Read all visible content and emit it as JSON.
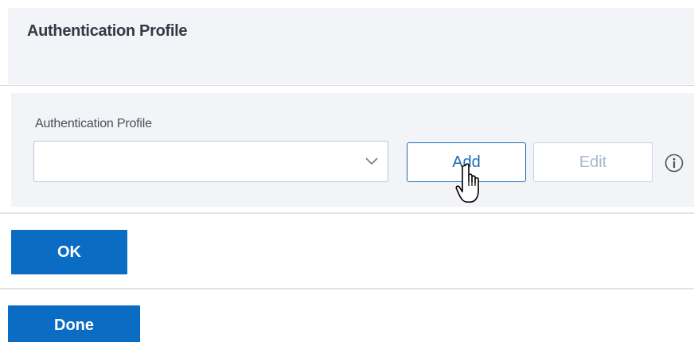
{
  "header": {
    "title": "Authentication Profile"
  },
  "form": {
    "field_label": "Authentication Profile",
    "select_value": "",
    "add_label": "Add",
    "edit_label": "Edit"
  },
  "actions": {
    "ok_label": "OK",
    "done_label": "Done"
  },
  "icons": {
    "dropdown": "chevron-down-icon",
    "info": "info-icon",
    "cursor": "hand-pointer-cursor-icon"
  },
  "colors": {
    "accent": "#0a6cc2",
    "panel_bg": "#f2f4f7",
    "disabled_text": "#a8bbd2"
  }
}
